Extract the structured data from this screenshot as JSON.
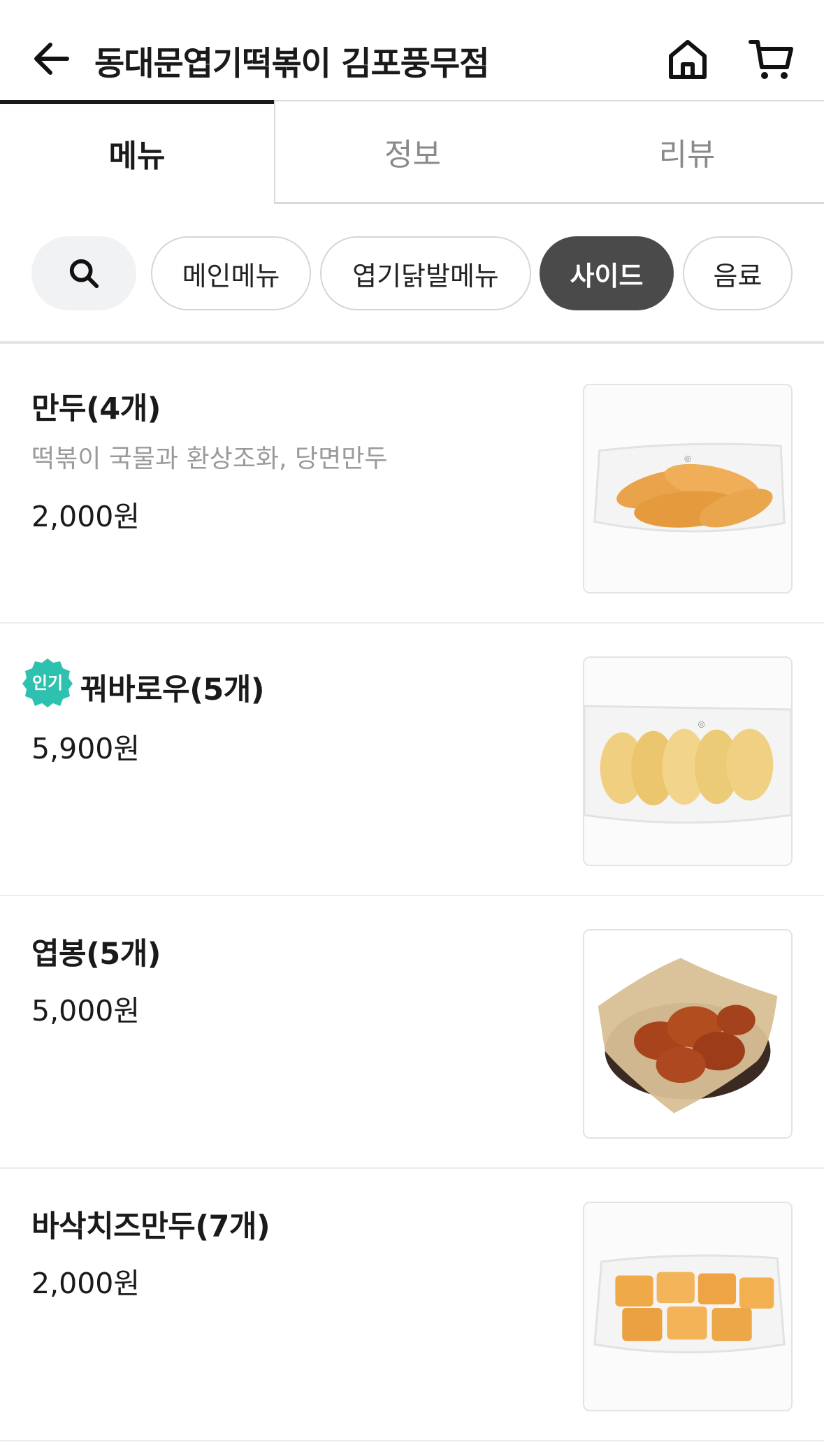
{
  "header": {
    "title": "동대문엽기떡볶이 김포풍무점",
    "back_icon": "arrow-left-icon",
    "home_icon": "home-icon",
    "cart_icon": "cart-icon"
  },
  "tabs": [
    {
      "label": "메뉴",
      "active": true
    },
    {
      "label": "정보",
      "active": false
    },
    {
      "label": "리뷰",
      "active": false
    }
  ],
  "categories": [
    {
      "label": "메인메뉴",
      "selected": false
    },
    {
      "label": "엽기닭발메뉴",
      "selected": false
    },
    {
      "label": "사이드",
      "selected": true
    },
    {
      "label": "음료",
      "selected": false
    }
  ],
  "menu_items": [
    {
      "name": "만두(4개)",
      "description": "떡볶이 국물과 환상조화, 당면만두",
      "price": "2,000원",
      "popular": false
    },
    {
      "name": "꿔바로우(5개)",
      "description": "",
      "price": "5,900원",
      "popular": true,
      "badge": "인기"
    },
    {
      "name": "엽봉(5개)",
      "description": "",
      "price": "5,000원",
      "popular": false
    },
    {
      "name": "바삭치즈만두(7개)",
      "description": "",
      "price": "2,000원",
      "popular": false
    }
  ],
  "colors": {
    "accent_dark": "#4a4a4a",
    "popular_badge": "#2fc1b0",
    "muted_text": "#9a9a9a"
  }
}
